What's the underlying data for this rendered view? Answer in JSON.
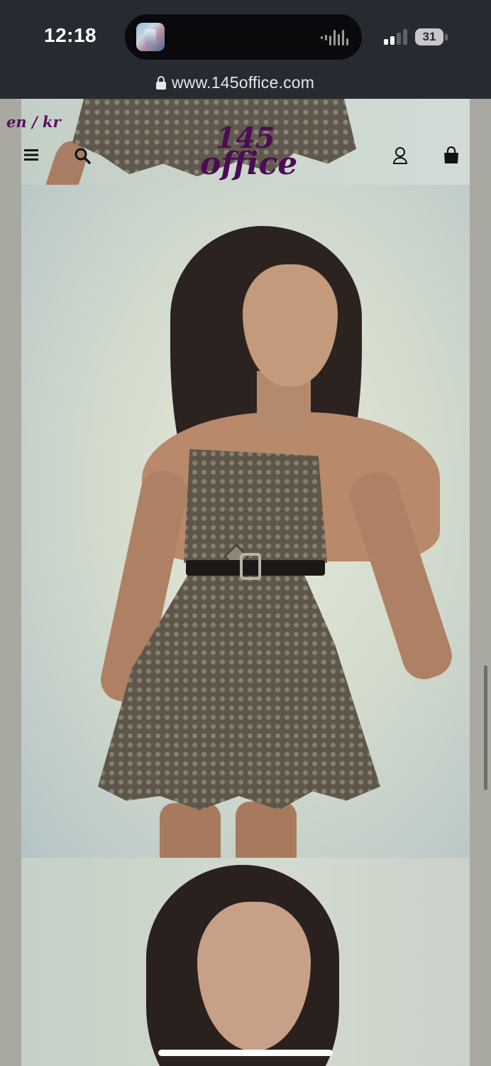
{
  "status_bar": {
    "time": "12:18",
    "battery": "31",
    "now_playing_icon": "music-app-thumbnail",
    "signal_bars": 2,
    "signal_bars_total": 4
  },
  "browser": {
    "url": "www.145office.com",
    "lock_icon": "lock-icon"
  },
  "site_header": {
    "language_switch": "en / kr",
    "logo": {
      "line1": "145",
      "line2": "office"
    },
    "icons": {
      "menu": "menu-icon",
      "search": "search-icon",
      "account": "account-icon",
      "cart": "cart-icon"
    }
  },
  "gallery": {
    "images": [
      {
        "subject": "dress-hem-detail"
      },
      {
        "subject": "model-in-eyelet-mini-dress"
      },
      {
        "subject": "model-portrait"
      }
    ]
  },
  "colors": {
    "chrome": "#262a31",
    "brand": "#4b0b55",
    "page_background": "#a9a9a1"
  }
}
